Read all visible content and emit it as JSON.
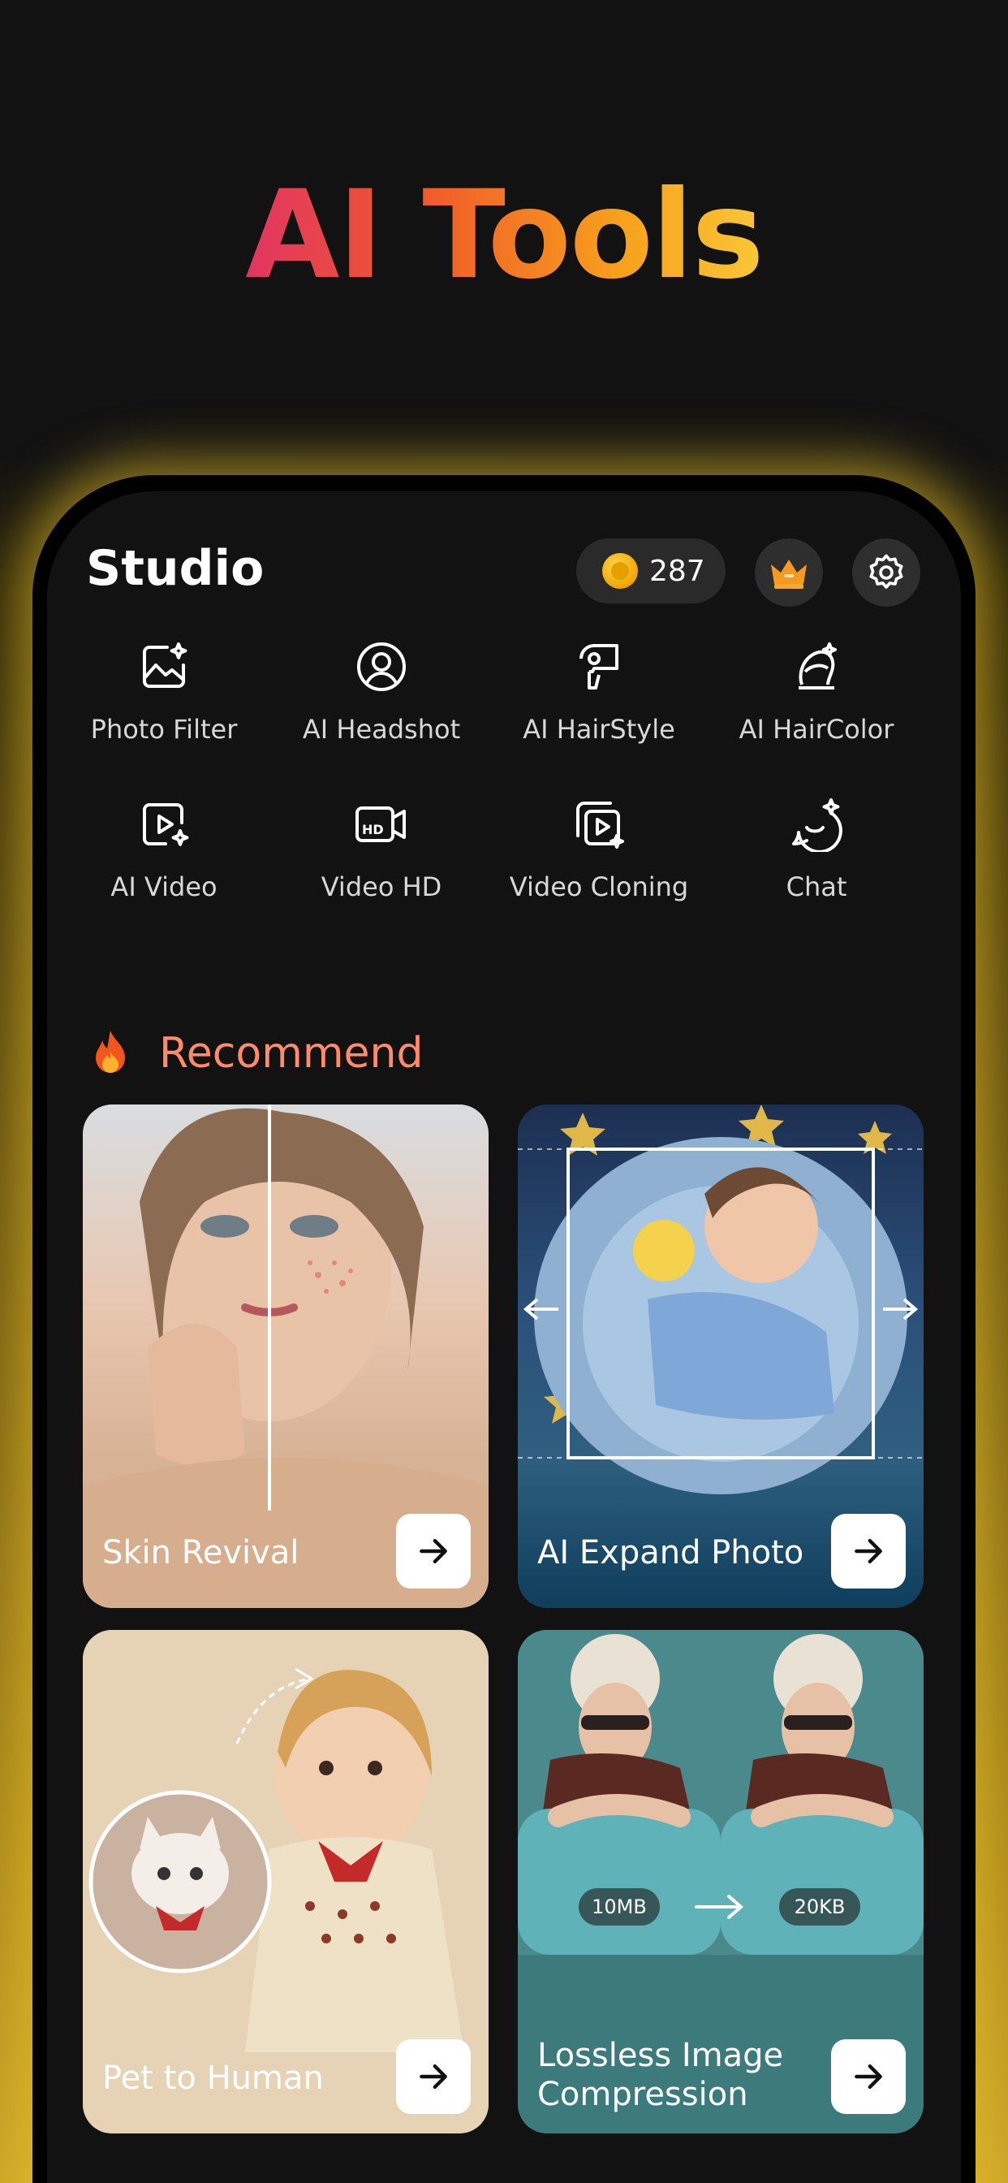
{
  "hero": {
    "title": "AI Tools"
  },
  "header": {
    "title": "Studio",
    "coin_count": "287"
  },
  "tools": [
    {
      "label": "Photo Filter",
      "icon": "photo-filter-icon"
    },
    {
      "label": "AI Headshot",
      "icon": "headshot-icon"
    },
    {
      "label": "AI HairStyle",
      "icon": "hair-dryer-icon"
    },
    {
      "label": "AI HairColor",
      "icon": "hair-color-icon"
    },
    {
      "label": "AI Video",
      "icon": "ai-video-icon"
    },
    {
      "label": "Video HD",
      "icon": "video-hd-icon"
    },
    {
      "label": "Video Cloning",
      "icon": "video-cloning-icon"
    },
    {
      "label": "Chat",
      "icon": "chat-icon"
    }
  ],
  "recommend": {
    "title": "Recommend",
    "cards": [
      {
        "label": "Skin Revival"
      },
      {
        "label": "AI Expand Photo"
      },
      {
        "label": "Pet to Human"
      },
      {
        "label": "Lossless Image Compression",
        "badge_before": "10MB",
        "badge_after": "20KB"
      }
    ]
  },
  "colors": {
    "accent_title": "#ff8b6a",
    "glow": "#f0c828",
    "background": "#121212"
  }
}
